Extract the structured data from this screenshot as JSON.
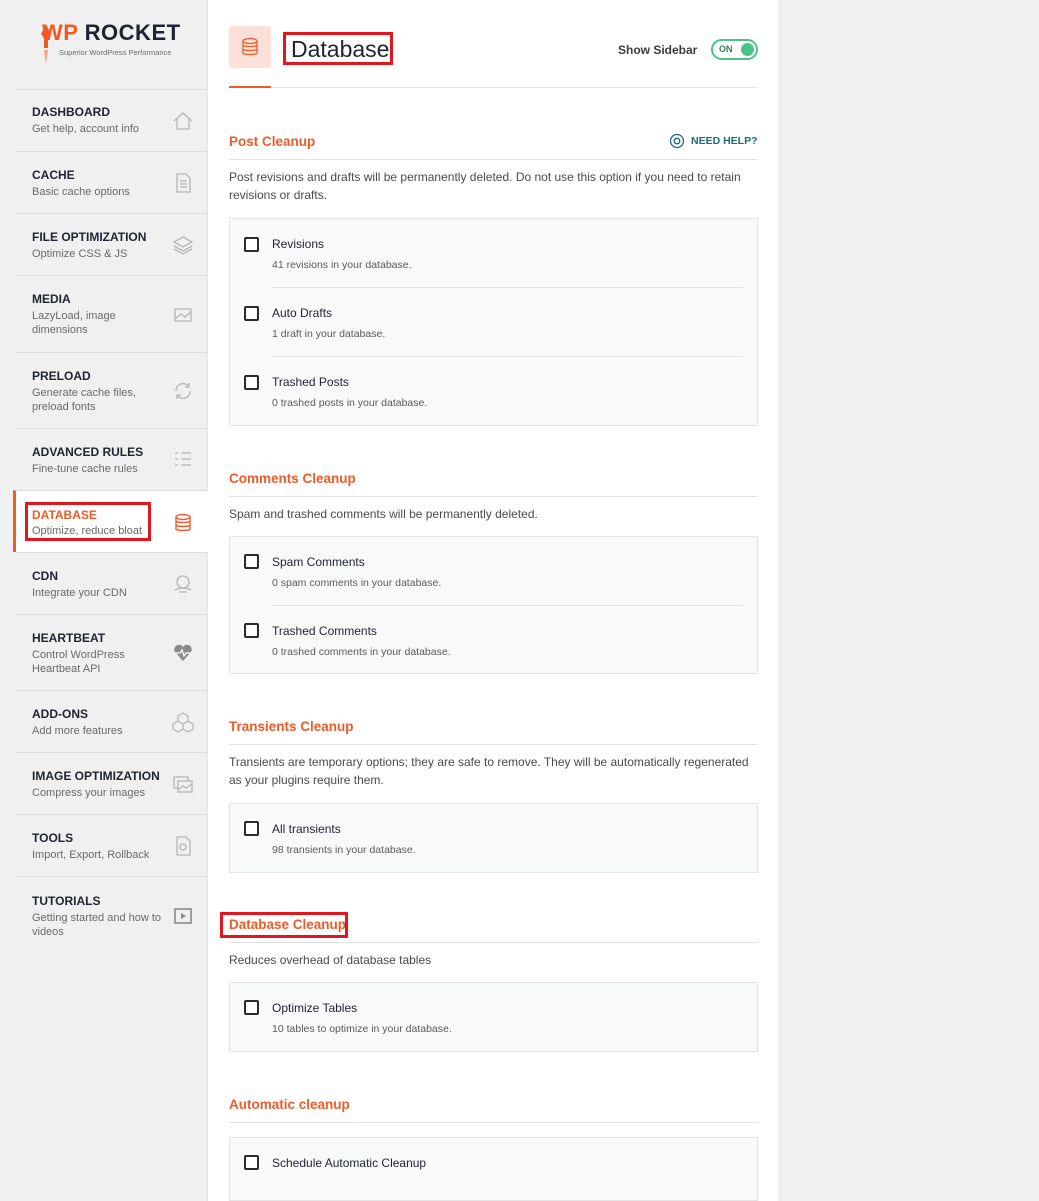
{
  "logo": {
    "wp": "WP",
    "rocket": "ROCKET",
    "tagline": "Superior WordPress Performance"
  },
  "nav": [
    {
      "title": "DASHBOARD",
      "desc": "Get help, account info",
      "icon": "home-icon"
    },
    {
      "title": "CACHE",
      "desc": "Basic cache options",
      "icon": "file-icon"
    },
    {
      "title": "FILE OPTIMIZATION",
      "desc": "Optimize CSS & JS",
      "icon": "layers-icon"
    },
    {
      "title": "MEDIA",
      "desc": "LazyLoad, image dimensions",
      "icon": "image-icon"
    },
    {
      "title": "PRELOAD",
      "desc": "Generate cache files, preload fonts",
      "icon": "refresh-icon"
    },
    {
      "title": "ADVANCED RULES",
      "desc": "Fine-tune cache rules",
      "icon": "list-icon"
    },
    {
      "title": "DATABASE",
      "desc": "Optimize, reduce bloat",
      "icon": "database-icon"
    },
    {
      "title": "CDN",
      "desc": "Integrate your CDN",
      "icon": "cdn-icon"
    },
    {
      "title": "HEARTBEAT",
      "desc": "Control WordPress Heartbeat API",
      "icon": "heartbeat-icon"
    },
    {
      "title": "ADD-ONS",
      "desc": "Add more features",
      "icon": "cubes-icon"
    },
    {
      "title": "IMAGE OPTIMIZATION",
      "desc": "Compress your images",
      "icon": "images-icon"
    },
    {
      "title": "TOOLS",
      "desc": "Import, Export, Rollback",
      "icon": "tools-file-icon"
    },
    {
      "title": "TUTORIALS",
      "desc": "Getting started and how to videos",
      "icon": "video-icon"
    }
  ],
  "header": {
    "title": "Database",
    "show_sidebar": "Show Sidebar",
    "toggle": "ON"
  },
  "need_help": "NEED HELP?",
  "sections": {
    "post": {
      "title": "Post Cleanup",
      "desc": "Post revisions and drafts will be permanently deleted. Do not use this option if you need to retain revisions or drafts.",
      "options": [
        {
          "label": "Revisions",
          "sub": "41 revisions in your database."
        },
        {
          "label": "Auto Drafts",
          "sub": "1 draft in your database."
        },
        {
          "label": "Trashed Posts",
          "sub": "0 trashed posts in your database."
        }
      ]
    },
    "comments": {
      "title": "Comments Cleanup",
      "desc": "Spam and trashed comments will be permanently deleted.",
      "options": [
        {
          "label": "Spam Comments",
          "sub": "0 spam comments in your database."
        },
        {
          "label": "Trashed Comments",
          "sub": "0 trashed comments in your database."
        }
      ]
    },
    "transients": {
      "title": "Transients Cleanup",
      "desc": "Transients are temporary options; they are safe to remove. They will be automatically regenerated as your plugins require them.",
      "options": [
        {
          "label": "All transients",
          "sub": "98 transients in your database."
        }
      ]
    },
    "database": {
      "title": "Database Cleanup",
      "desc": "Reduces overhead of database tables",
      "options": [
        {
          "label": "Optimize Tables",
          "sub": "10 tables to optimize in your database."
        }
      ]
    },
    "automatic": {
      "title": "Automatic cleanup",
      "options": [
        {
          "label": "Schedule Automatic Cleanup"
        }
      ]
    }
  },
  "colors": {
    "accent": "#f05a28",
    "toggle": "#4cc38a",
    "highlight": "#e0171f"
  }
}
